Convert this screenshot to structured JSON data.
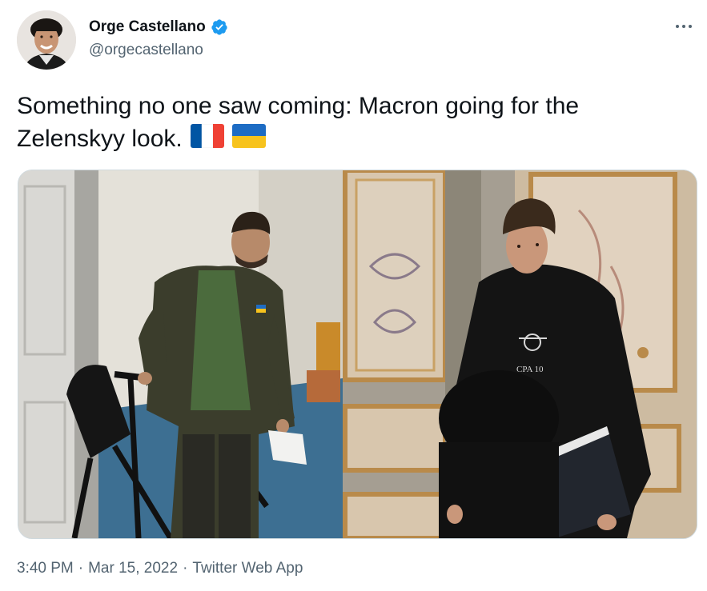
{
  "author": {
    "display_name": "Orge Castellano",
    "handle": "@orgecastellano",
    "avatar_icon": "avatar-photo",
    "verified_icon": "verified-badge-icon",
    "verified_color": "#1d9bf0"
  },
  "more_icon": "more-horizontal-icon",
  "tweet": {
    "text": "Something no one saw coming: Macron going for the Zelenskyy look.",
    "emoji": [
      "flag-france-icon",
      "flag-ukraine-icon"
    ]
  },
  "media": {
    "left_photo_text": "",
    "right_photo_text": "CPA 10"
  },
  "meta": {
    "time": "3:40 PM",
    "separator_1": "·",
    "date": "Mar 15, 2022",
    "separator_2": "·",
    "source": "Twitter Web App"
  },
  "colors": {
    "text_primary": "#0f1419",
    "text_secondary": "#536471",
    "border": "#cfd9de"
  }
}
